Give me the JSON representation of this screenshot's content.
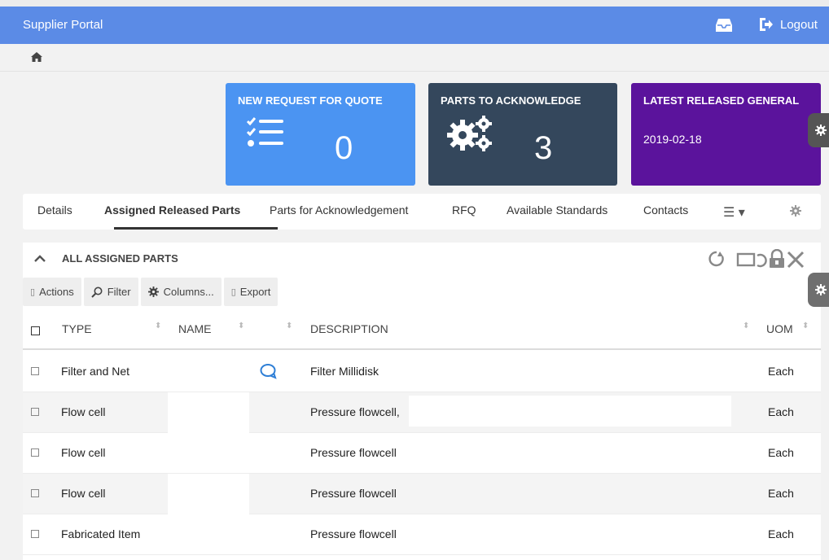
{
  "header": {
    "app_title": "Supplier Portal",
    "logout_label": "Logout"
  },
  "tiles": [
    {
      "title": "NEW REQUEST FOR QUOTE",
      "value": "0"
    },
    {
      "title": "PARTS TO ACKNOWLEDGE",
      "value": "3"
    },
    {
      "title": "LATEST RELEASED GENERAL",
      "value": "2019-02-18"
    }
  ],
  "tabs": [
    {
      "label": "Details"
    },
    {
      "label": "Assigned Released Parts",
      "active": true
    },
    {
      "label": "Parts for Acknowledgement"
    },
    {
      "label": "RFQ"
    },
    {
      "label": "Available Standards"
    },
    {
      "label": "Contacts"
    }
  ],
  "panel": {
    "title": "ALL ASSIGNED PARTS",
    "buttons": {
      "actions": "Actions",
      "filter": "Filter",
      "columns": "Columns...",
      "export": "Export"
    },
    "columns": {
      "type": "TYPE",
      "name": "NAME",
      "description": "DESCRIPTION",
      "uom": "UOM"
    },
    "rows": [
      {
        "type": "Filter and Net",
        "description": "Filter Millidisk",
        "uom": "Each"
      },
      {
        "type": "Flow cell",
        "description": "Pressure flowcell,",
        "uom": "Each"
      },
      {
        "type": "Flow cell",
        "description": "Pressure flowcell",
        "uom": "Each"
      },
      {
        "type": "Flow cell",
        "description": "Pressure flowcell",
        "uom": "Each"
      },
      {
        "type": "Fabricated Item",
        "description": "Pressure flowcell",
        "uom": "Each"
      }
    ]
  },
  "colors": {
    "topbar": "#5b8be6",
    "tile_rfq": "#4b94f2",
    "tile_ack": "#34475c",
    "tile_general": "#5b139c"
  },
  "icons": [
    "inbox-icon",
    "logout-icon",
    "home-icon",
    "checklist-icon",
    "gears-icon",
    "gear-icon",
    "hamburger-icon",
    "chevron-up-icon",
    "refresh-icon",
    "restore-icon",
    "lock-icon",
    "close-icon",
    "search-icon",
    "chat-icon"
  ]
}
